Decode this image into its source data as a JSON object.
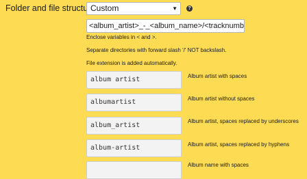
{
  "section": {
    "label": "Folder and file structure"
  },
  "structure_select": {
    "value": "Custom",
    "arrow": "▼"
  },
  "help": {
    "glyph": "?"
  },
  "pattern": {
    "value": "<album_artist>_-_<album_name>/<tracknumber>"
  },
  "notes": [
    "Enclose variables in < and >.",
    "Separate directories with forward slash '/' NOT backslash.",
    "File extension is added automatically."
  ],
  "examples": [
    {
      "value": "album artist",
      "description": "Album artist with spaces"
    },
    {
      "value": "albumartist",
      "description": "Album artist without spaces"
    },
    {
      "value": "album_artist",
      "description": "Album artist, spaces replaced by underscores"
    },
    {
      "value": "album-artist",
      "description": "Album artist, spaces replaced by hyphens"
    },
    {
      "value": "",
      "description": "Album name with spaces"
    }
  ]
}
